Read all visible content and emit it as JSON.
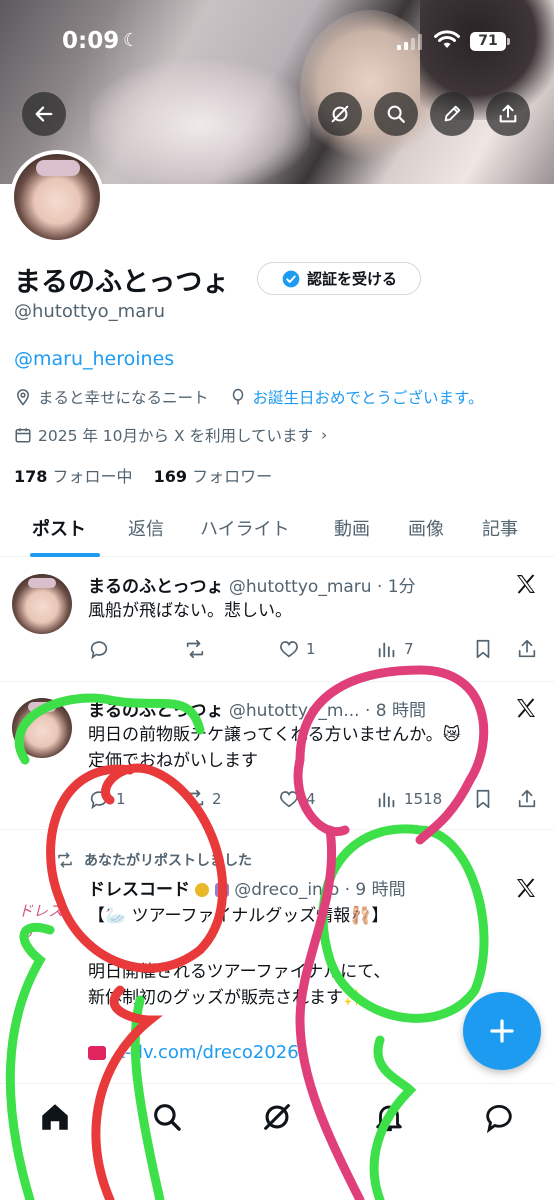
{
  "status_bar": {
    "time": "0:09",
    "battery": "71"
  },
  "profile": {
    "name": "まるのふとっつょ",
    "verify_button": "認証を受ける",
    "handle": "@hutottyo_maru",
    "bio_link": "@maru_heroines",
    "location": "まると幸せになるニート",
    "website": "お誕生日おめでとうございます。",
    "joined": "2025 年 10月から X を利用しています",
    "following_count": "178",
    "following_label": "フォロー中",
    "followers_count": "169",
    "followers_label": "フォロワー"
  },
  "tabs": [
    "ポスト",
    "返信",
    "ハイライト",
    "動画",
    "画像",
    "記事"
  ],
  "posts": [
    {
      "author": "まるのふとっつょ",
      "meta": "@hutottyo_maru · 1分",
      "text": [
        "風船が飛ばない。悲しい。"
      ],
      "replies": "",
      "reposts": "",
      "likes": "1",
      "views": "7"
    },
    {
      "author": "まるのふとっつょ",
      "meta": "@hutottyo_m... · 8 時間",
      "text": [
        "明日の前物販チケ譲ってくれる方いませんか。😿",
        "定価でおねがいします"
      ],
      "replies": "1",
      "reposts": "2",
      "likes": "4",
      "views": "1518"
    },
    {
      "repost_label": "あなたがリポストしました",
      "logo_text": "ドレスお",
      "author": "ドレスコード",
      "meta": "@dreco_info · 9 時間",
      "text": [
        "【🦢 ツアーファイナルグッズ情報🩰】",
        "",
        "明日開催されるツアーファイナルにて、",
        "新体制初のグッズが販売されます✨",
        "",
        ""
      ],
      "link": "t-dv.com/dreco2026"
    }
  ],
  "colors": {
    "accent": "#1d9bf0",
    "text": "#0f1419",
    "secondary": "#536471",
    "scribble_green": "#3ee04a",
    "scribble_red": "#e83a3a",
    "scribble_pink": "#e0407a"
  }
}
